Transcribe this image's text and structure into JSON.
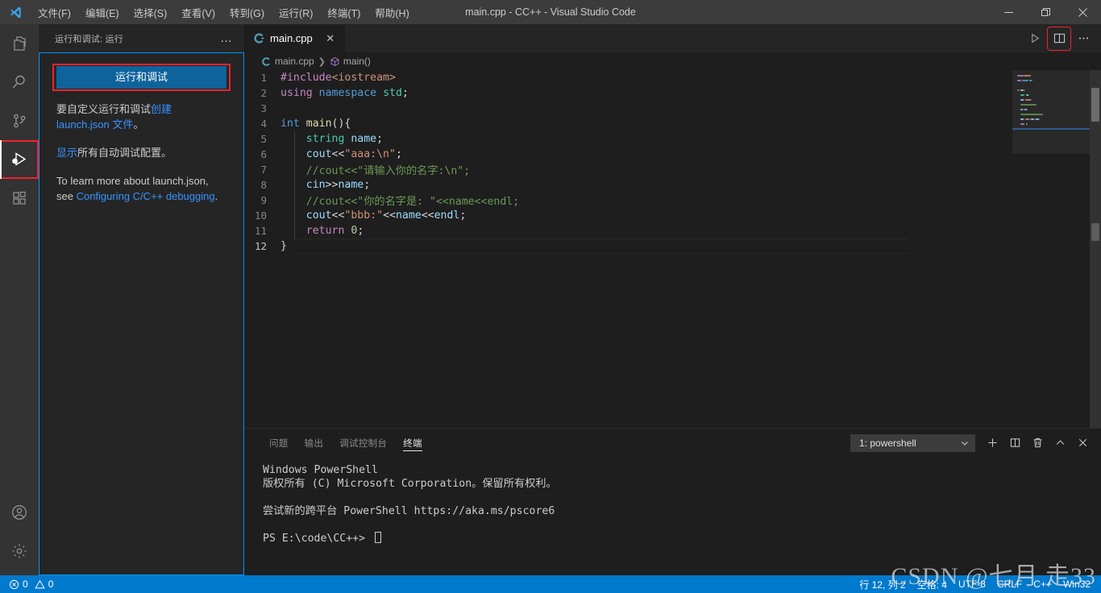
{
  "window": {
    "title": "main.cpp - CC++ - Visual Studio Code",
    "logo_icon": "vscode-logo-icon",
    "controls": {
      "minimize": "minimize-icon",
      "maximize": "restore-icon",
      "close": "close-icon"
    }
  },
  "menubar": {
    "items": [
      {
        "label": "文件(F)",
        "name": "menu-file"
      },
      {
        "label": "编辑(E)",
        "name": "menu-edit"
      },
      {
        "label": "选择(S)",
        "name": "menu-selection"
      },
      {
        "label": "查看(V)",
        "name": "menu-view"
      },
      {
        "label": "转到(G)",
        "name": "menu-go"
      },
      {
        "label": "运行(R)",
        "name": "menu-run"
      },
      {
        "label": "终端(T)",
        "name": "menu-terminal"
      },
      {
        "label": "帮助(H)",
        "name": "menu-help"
      }
    ]
  },
  "activitybar": {
    "items": [
      {
        "name": "activity-explorer",
        "icon": "files-icon",
        "active": false
      },
      {
        "name": "activity-search",
        "icon": "search-icon",
        "active": false
      },
      {
        "name": "activity-source-control",
        "icon": "source-control-icon",
        "active": false
      },
      {
        "name": "activity-run-and-debug",
        "icon": "run-and-debug-icon",
        "active": true,
        "highlight": "red-box"
      },
      {
        "name": "activity-extensions",
        "icon": "extensions-icon",
        "active": false
      }
    ],
    "bottom": [
      {
        "name": "activity-account",
        "icon": "account-icon"
      },
      {
        "name": "activity-settings",
        "icon": "gear-icon"
      }
    ]
  },
  "sidebar": {
    "title": "运行和调试: 运行",
    "more_actions": "…",
    "run_debug_button": "运行和调试",
    "run_debug_button_highlight": "red-box",
    "paragraph1": {
      "prefix": "要自定义运行和调试",
      "link": "创建 launch.json 文件",
      "suffix": "。"
    },
    "paragraph2": {
      "link": "显示",
      "suffix": "所有自动调试配置。"
    },
    "paragraph3": {
      "text": "To learn more about launch.json, see ",
      "link": "Configuring C/C++ debugging",
      "suffix": "."
    }
  },
  "editor": {
    "tab": {
      "label": "main.cpp",
      "icon": "cpp-file-icon",
      "close_icon": "close-icon"
    },
    "actions": [
      {
        "name": "run-code-button",
        "icon": "play-icon",
        "highlight": "none"
      },
      {
        "name": "split-editor-button",
        "icon": "split-editor-icon",
        "highlight": "red-box"
      },
      {
        "name": "more-actions-button",
        "icon": "ellipsis-icon",
        "highlight": "none"
      }
    ],
    "breadcrumbs": [
      {
        "label": "main.cpp",
        "icon": "cpp-file-icon"
      },
      {
        "label": "main()",
        "icon": "symbol-method-icon"
      }
    ],
    "current_line": 12,
    "lines": [
      {
        "n": 1,
        "tokens": [
          {
            "t": "#include",
            "c": "tk-pp"
          },
          {
            "t": "<iostream>",
            "c": "tk-inc"
          }
        ]
      },
      {
        "n": 2,
        "tokens": [
          {
            "t": "using",
            "c": "tk-pp"
          },
          {
            "t": " ",
            "c": "tk-punc"
          },
          {
            "t": "namespace",
            "c": "tk-kw"
          },
          {
            "t": " ",
            "c": "tk-punc"
          },
          {
            "t": "std",
            "c": "tk-ns"
          },
          {
            "t": ";",
            "c": "tk-punc"
          }
        ]
      },
      {
        "n": 3,
        "tokens": []
      },
      {
        "n": 4,
        "tokens": [
          {
            "t": "int",
            "c": "tk-kw"
          },
          {
            "t": " ",
            "c": "tk-punc"
          },
          {
            "t": "main",
            "c": "tk-fn"
          },
          {
            "t": "(){",
            "c": "tk-punc"
          }
        ]
      },
      {
        "n": 5,
        "tokens": [
          {
            "t": "    ",
            "c": "tk-punc"
          },
          {
            "t": "string",
            "c": "tk-ns"
          },
          {
            "t": " ",
            "c": "tk-punc"
          },
          {
            "t": "name",
            "c": "tk-var"
          },
          {
            "t": ";",
            "c": "tk-punc"
          }
        ]
      },
      {
        "n": 6,
        "tokens": [
          {
            "t": "    ",
            "c": "tk-punc"
          },
          {
            "t": "cout",
            "c": "tk-var"
          },
          {
            "t": "<<",
            "c": "tk-punc"
          },
          {
            "t": "\"aaa:\\n\"",
            "c": "tk-str"
          },
          {
            "t": ";",
            "c": "tk-punc"
          }
        ]
      },
      {
        "n": 7,
        "tokens": [
          {
            "t": "    ",
            "c": "tk-punc"
          },
          {
            "t": "//cout<<\"请输入你的名字:\\n\";",
            "c": "tk-cmt"
          }
        ]
      },
      {
        "n": 8,
        "tokens": [
          {
            "t": "    ",
            "c": "tk-punc"
          },
          {
            "t": "cin",
            "c": "tk-var"
          },
          {
            "t": ">>",
            "c": "tk-punc"
          },
          {
            "t": "name",
            "c": "tk-var"
          },
          {
            "t": ";",
            "c": "tk-punc"
          }
        ]
      },
      {
        "n": 9,
        "tokens": [
          {
            "t": "    ",
            "c": "tk-punc"
          },
          {
            "t": "//cout<<\"你的名字是: \"<<name<<endl;",
            "c": "tk-cmt"
          }
        ]
      },
      {
        "n": 10,
        "tokens": [
          {
            "t": "    ",
            "c": "tk-punc"
          },
          {
            "t": "cout",
            "c": "tk-var"
          },
          {
            "t": "<<",
            "c": "tk-punc"
          },
          {
            "t": "\"bbb:\"",
            "c": "tk-str"
          },
          {
            "t": "<<",
            "c": "tk-punc"
          },
          {
            "t": "name",
            "c": "tk-var"
          },
          {
            "t": "<<",
            "c": "tk-punc"
          },
          {
            "t": "endl",
            "c": "tk-var"
          },
          {
            "t": ";",
            "c": "tk-punc"
          }
        ]
      },
      {
        "n": 11,
        "tokens": [
          {
            "t": "    ",
            "c": "tk-punc"
          },
          {
            "t": "return",
            "c": "tk-pp"
          },
          {
            "t": " ",
            "c": "tk-punc"
          },
          {
            "t": "0",
            "c": "tk-num"
          },
          {
            "t": ";",
            "c": "tk-punc"
          }
        ]
      },
      {
        "n": 12,
        "tokens": [
          {
            "t": "}",
            "c": "tk-punc"
          }
        ]
      }
    ]
  },
  "panel": {
    "tabs": [
      {
        "label": "问题",
        "name": "panel-tab-problems",
        "active": false
      },
      {
        "label": "输出",
        "name": "panel-tab-output",
        "active": false
      },
      {
        "label": "调试控制台",
        "name": "panel-tab-debug-console",
        "active": false
      },
      {
        "label": "终端",
        "name": "panel-tab-terminal",
        "active": true
      }
    ],
    "terminal_select": {
      "value": "1: powershell",
      "chevron_icon": "chevron-down-icon"
    },
    "actions": [
      {
        "name": "new-terminal-button",
        "icon": "plus-icon"
      },
      {
        "name": "split-terminal-button",
        "icon": "split-icon"
      },
      {
        "name": "kill-terminal-button",
        "icon": "trash-icon"
      },
      {
        "name": "maximize-panel-button",
        "icon": "chevron-up-icon"
      },
      {
        "name": "close-panel-button",
        "icon": "close-icon"
      }
    ],
    "terminal_output": [
      "Windows PowerShell",
      "版权所有 (C) Microsoft Corporation。保留所有权利。",
      "",
      "尝试新的跨平台 PowerShell https://aka.ms/pscore6",
      "",
      "PS E:\\code\\CC++> "
    ]
  },
  "statusbar": {
    "left": [
      {
        "name": "status-problems",
        "icon": "error-icon",
        "label": "0",
        "icon2": "warning-icon",
        "label2": "0"
      }
    ],
    "right": [
      {
        "name": "status-cursor-position",
        "label": "行 12, 列 2"
      },
      {
        "name": "status-indentation",
        "label": "空格: 4"
      },
      {
        "name": "status-encoding",
        "label": "UTF-8"
      },
      {
        "name": "status-eol",
        "label": "CRLF"
      },
      {
        "name": "status-language-mode",
        "label": "C++"
      },
      {
        "name": "status-platform",
        "label": "Win32"
      }
    ]
  },
  "watermark": {
    "text": "CSDN @七月 走33"
  },
  "colors": {
    "accent": "#007acc",
    "button": "#0e639c",
    "link": "#3794ff",
    "highlight_box": "#f1232a",
    "focus_border": "#0097fb",
    "editor_bg": "#1e1e1e",
    "sidebar_bg": "#252526",
    "activitybar_bg": "#333333",
    "titlebar_bg": "#3c3c3c"
  }
}
